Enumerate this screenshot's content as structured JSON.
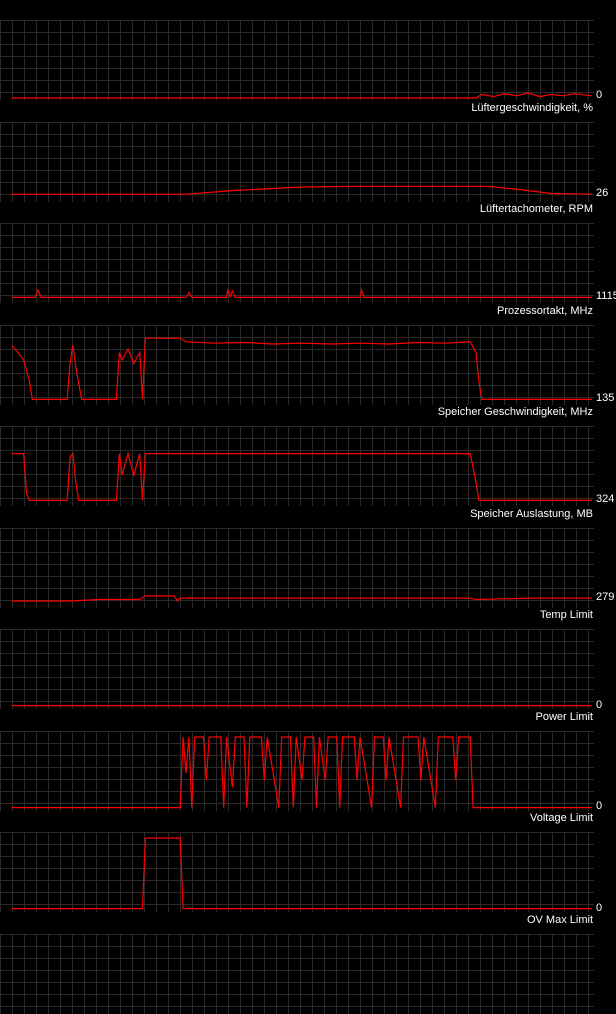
{
  "panels": [
    {
      "title": "",
      "value": "0",
      "series": [
        [
          0,
          0
        ],
        [
          0.8,
          0
        ],
        [
          0.81,
          0.05
        ],
        [
          0.83,
          0.02
        ],
        [
          0.85,
          0.06
        ],
        [
          0.87,
          0.03
        ],
        [
          0.89,
          0.07
        ],
        [
          0.91,
          0.02
        ],
        [
          0.93,
          0.05
        ],
        [
          0.95,
          0.03
        ],
        [
          0.97,
          0.06
        ],
        [
          1,
          0.03
        ]
      ]
    },
    {
      "title": "Lüftergeschwindigkeit, %",
      "value": "26",
      "series": [
        [
          0,
          0.08
        ],
        [
          0.3,
          0.08
        ],
        [
          0.38,
          0.13
        ],
        [
          0.5,
          0.18
        ],
        [
          0.6,
          0.19
        ],
        [
          0.82,
          0.19
        ],
        [
          0.88,
          0.14
        ],
        [
          0.93,
          0.09
        ],
        [
          1,
          0.08
        ]
      ]
    },
    {
      "title": "Lüftertachometer, RPM",
      "value": "1115",
      "series": [
        [
          0,
          0.05
        ],
        [
          0.04,
          0.05
        ],
        [
          0.045,
          0.15
        ],
        [
          0.05,
          0.05
        ],
        [
          0.3,
          0.05
        ],
        [
          0.305,
          0.12
        ],
        [
          0.31,
          0.05
        ],
        [
          0.37,
          0.05
        ],
        [
          0.372,
          0.16
        ],
        [
          0.376,
          0.06
        ],
        [
          0.38,
          0.14
        ],
        [
          0.385,
          0.05
        ],
        [
          0.6,
          0.05
        ],
        [
          0.603,
          0.15
        ],
        [
          0.607,
          0.05
        ],
        [
          1,
          0.05
        ]
      ]
    },
    {
      "title": "Prozessortakt, MHz",
      "value": "135",
      "series": [
        [
          0,
          0.8
        ],
        [
          0.02,
          0.6
        ],
        [
          0.03,
          0.3
        ],
        [
          0.035,
          0.05
        ],
        [
          0.095,
          0.05
        ],
        [
          0.1,
          0.55
        ],
        [
          0.105,
          0.8
        ],
        [
          0.11,
          0.5
        ],
        [
          0.12,
          0.05
        ],
        [
          0.18,
          0.05
        ],
        [
          0.185,
          0.7
        ],
        [
          0.19,
          0.6
        ],
        [
          0.2,
          0.75
        ],
        [
          0.21,
          0.55
        ],
        [
          0.22,
          0.7
        ],
        [
          0.225,
          0.05
        ],
        [
          0.23,
          0.9
        ],
        [
          0.29,
          0.9
        ],
        [
          0.3,
          0.85
        ],
        [
          0.35,
          0.83
        ],
        [
          0.4,
          0.84
        ],
        [
          0.45,
          0.82
        ],
        [
          0.5,
          0.83
        ],
        [
          0.55,
          0.82
        ],
        [
          0.6,
          0.83
        ],
        [
          0.65,
          0.82
        ],
        [
          0.7,
          0.84
        ],
        [
          0.75,
          0.83
        ],
        [
          0.79,
          0.85
        ],
        [
          0.8,
          0.7
        ],
        [
          0.805,
          0.3
        ],
        [
          0.81,
          0.05
        ],
        [
          1,
          0.05
        ]
      ]
    },
    {
      "title": "Speicher Geschwindigkeit, MHz",
      "value": "324",
      "series": [
        [
          0,
          0.7
        ],
        [
          0.02,
          0.7
        ],
        [
          0.025,
          0.15
        ],
        [
          0.03,
          0.05
        ],
        [
          0.095,
          0.05
        ],
        [
          0.1,
          0.65
        ],
        [
          0.105,
          0.7
        ],
        [
          0.11,
          0.3
        ],
        [
          0.115,
          0.05
        ],
        [
          0.18,
          0.05
        ],
        [
          0.185,
          0.7
        ],
        [
          0.19,
          0.4
        ],
        [
          0.2,
          0.7
        ],
        [
          0.21,
          0.4
        ],
        [
          0.22,
          0.7
        ],
        [
          0.225,
          0.05
        ],
        [
          0.23,
          0.7
        ],
        [
          0.79,
          0.7
        ],
        [
          0.8,
          0.3
        ],
        [
          0.805,
          0.05
        ],
        [
          1,
          0.05
        ]
      ]
    },
    {
      "title": "Speicher Auslastung, MB",
      "value": "279",
      "series": [
        [
          0,
          0.07
        ],
        [
          0.1,
          0.07
        ],
        [
          0.15,
          0.09
        ],
        [
          0.22,
          0.09
        ],
        [
          0.23,
          0.14
        ],
        [
          0.28,
          0.14
        ],
        [
          0.285,
          0.07
        ],
        [
          0.29,
          0.11
        ],
        [
          0.3,
          0.11
        ],
        [
          0.79,
          0.11
        ],
        [
          0.8,
          0.09
        ],
        [
          0.9,
          0.11
        ],
        [
          1,
          0.11
        ]
      ]
    },
    {
      "title": "Temp Limit",
      "value": "0",
      "series": [
        [
          0,
          0.02
        ],
        [
          1,
          0.02
        ]
      ]
    },
    {
      "title": "Power Limit",
      "value": "0",
      "series": [
        [
          0,
          0.02
        ],
        [
          0.29,
          0.02
        ],
        [
          0.295,
          1
        ],
        [
          0.3,
          0.5
        ],
        [
          0.305,
          1
        ],
        [
          0.31,
          0.02
        ],
        [
          0.315,
          1
        ],
        [
          0.33,
          1
        ],
        [
          0.335,
          0.4
        ],
        [
          0.34,
          1
        ],
        [
          0.36,
          1
        ],
        [
          0.365,
          0.02
        ],
        [
          0.37,
          1
        ],
        [
          0.38,
          0.3
        ],
        [
          0.385,
          1
        ],
        [
          0.4,
          1
        ],
        [
          0.405,
          0.02
        ],
        [
          0.41,
          1
        ],
        [
          0.43,
          1
        ],
        [
          0.435,
          0.4
        ],
        [
          0.44,
          1
        ],
        [
          0.46,
          0.02
        ],
        [
          0.465,
          1
        ],
        [
          0.48,
          1
        ],
        [
          0.485,
          0.02
        ],
        [
          0.49,
          1
        ],
        [
          0.5,
          0.4
        ],
        [
          0.505,
          1
        ],
        [
          0.52,
          1
        ],
        [
          0.525,
          0.02
        ],
        [
          0.53,
          1
        ],
        [
          0.54,
          0.4
        ],
        [
          0.545,
          1
        ],
        [
          0.56,
          1
        ],
        [
          0.565,
          0.02
        ],
        [
          0.57,
          1
        ],
        [
          0.59,
          1
        ],
        [
          0.595,
          0.4
        ],
        [
          0.6,
          1
        ],
        [
          0.62,
          0.02
        ],
        [
          0.625,
          1
        ],
        [
          0.64,
          1
        ],
        [
          0.645,
          0.4
        ],
        [
          0.65,
          1
        ],
        [
          0.67,
          0.02
        ],
        [
          0.675,
          1
        ],
        [
          0.7,
          1
        ],
        [
          0.705,
          0.4
        ],
        [
          0.71,
          1
        ],
        [
          0.73,
          0.02
        ],
        [
          0.735,
          1
        ],
        [
          0.76,
          1
        ],
        [
          0.765,
          0.4
        ],
        [
          0.77,
          1
        ],
        [
          0.79,
          1
        ],
        [
          0.795,
          0.02
        ],
        [
          1,
          0.02
        ]
      ]
    },
    {
      "title": "Voltage Limit",
      "value": "0",
      "series": [
        [
          0,
          0.02
        ],
        [
          0.225,
          0.02
        ],
        [
          0.23,
          1
        ],
        [
          0.29,
          1
        ],
        [
          0.295,
          0.02
        ],
        [
          1,
          0.02
        ]
      ]
    },
    {
      "title": "OV Max Limit",
      "value": "",
      "series": []
    }
  ],
  "colors": {
    "background": "#000000",
    "grid": "#2a2a2a",
    "line": "#ff0000",
    "text": "#ffffff"
  }
}
